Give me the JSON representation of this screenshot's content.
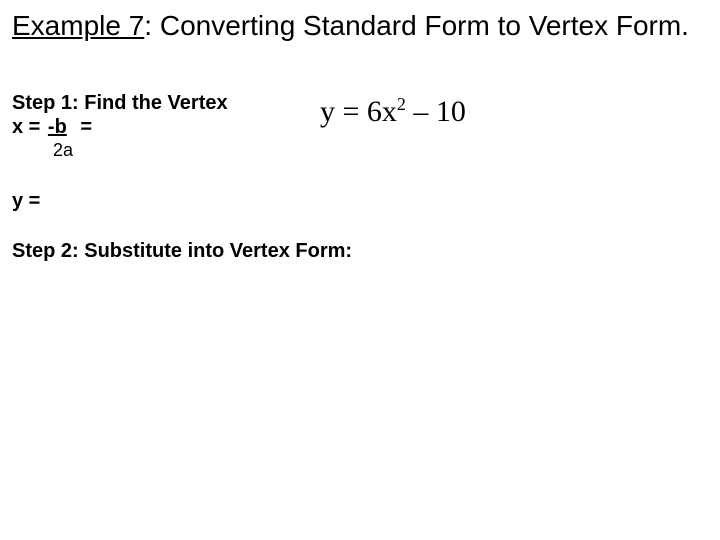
{
  "title": {
    "underlined": "Example 7",
    "rest": ":  Converting Standard Form to Vertex Form."
  },
  "step1": {
    "label": "Step 1:  Find the Vertex",
    "x_prefix": "x =  ",
    "x_numerator": "-b",
    "x_equals2": "  =",
    "x_denominator": "2a"
  },
  "equation": {
    "lhs": "y = 6x",
    "exp": "2",
    "rhs": " – 10"
  },
  "y_eq": "y =",
  "step2": {
    "label": "Step 2:  Substitute into Vertex Form:"
  }
}
